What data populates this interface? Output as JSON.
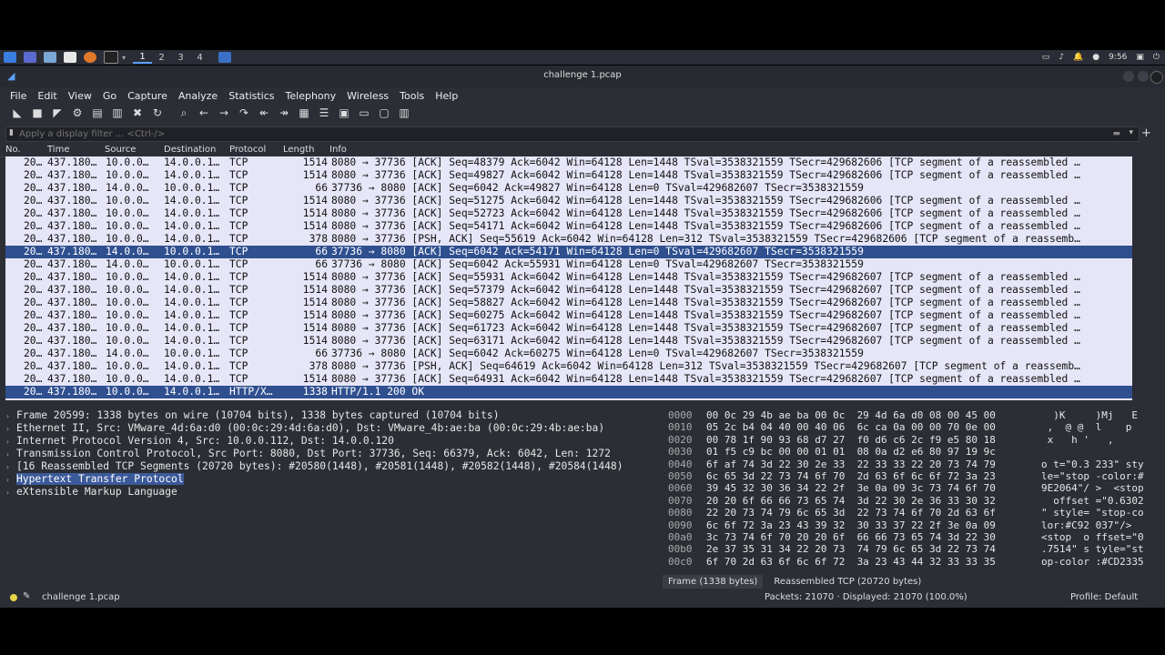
{
  "taskbar": {
    "workspaces": [
      "1",
      "2",
      "3",
      "4"
    ],
    "clock": "9:56"
  },
  "window": {
    "title": "challenge 1.pcap"
  },
  "menu": [
    "File",
    "Edit",
    "View",
    "Go",
    "Capture",
    "Analyze",
    "Statistics",
    "Telephony",
    "Wireless",
    "Tools",
    "Help"
  ],
  "filter": {
    "placeholder": "Apply a display filter ... <Ctrl-/>"
  },
  "packet_list": {
    "columns": [
      "No.",
      "Time",
      "Source",
      "Destination",
      "Protocol",
      "Length",
      "Info"
    ],
    "rows": [
      {
        "no": "20…",
        "time": "437.180…",
        "src": "10.0.0…",
        "dst": "14.0.0.1…",
        "proto": "TCP",
        "len": "1514",
        "info": "8080 → 37736 [ACK] Seq=48379 Ack=6042 Win=64128 Len=1448 TSval=3538321559 TSecr=429682606 [TCP segment of a reassembled …"
      },
      {
        "no": "20…",
        "time": "437.180…",
        "src": "10.0.0…",
        "dst": "14.0.0.1…",
        "proto": "TCP",
        "len": "1514",
        "info": "8080 → 37736 [ACK] Seq=49827 Ack=6042 Win=64128 Len=1448 TSval=3538321559 TSecr=429682606 [TCP segment of a reassembled …"
      },
      {
        "no": "20…",
        "time": "437.180…",
        "src": "14.0.0…",
        "dst": "10.0.0.1…",
        "proto": "TCP",
        "len": "66",
        "info": "37736 → 8080 [ACK] Seq=6042 Ack=49827 Win=64128 Len=0 TSval=429682607 TSecr=3538321559"
      },
      {
        "no": "20…",
        "time": "437.180…",
        "src": "10.0.0…",
        "dst": "14.0.0.1…",
        "proto": "TCP",
        "len": "1514",
        "info": "8080 → 37736 [ACK] Seq=51275 Ack=6042 Win=64128 Len=1448 TSval=3538321559 TSecr=429682606 [TCP segment of a reassembled …"
      },
      {
        "no": "20…",
        "time": "437.180…",
        "src": "10.0.0…",
        "dst": "14.0.0.1…",
        "proto": "TCP",
        "len": "1514",
        "info": "8080 → 37736 [ACK] Seq=52723 Ack=6042 Win=64128 Len=1448 TSval=3538321559 TSecr=429682606 [TCP segment of a reassembled …"
      },
      {
        "no": "20…",
        "time": "437.180…",
        "src": "10.0.0…",
        "dst": "14.0.0.1…",
        "proto": "TCP",
        "len": "1514",
        "info": "8080 → 37736 [ACK] Seq=54171 Ack=6042 Win=64128 Len=1448 TSval=3538321559 TSecr=429682606 [TCP segment of a reassembled …"
      },
      {
        "no": "20…",
        "time": "437.180…",
        "src": "10.0.0…",
        "dst": "14.0.0.1…",
        "proto": "TCP",
        "len": "378",
        "info": "8080 → 37736 [PSH, ACK] Seq=55619 Ack=6042 Win=64128 Len=312 TSval=3538321559 TSecr=429682606 [TCP segment of a reassemb…"
      },
      {
        "no": "20…",
        "time": "437.180…",
        "src": "14.0.0…",
        "dst": "10.0.0.1…",
        "proto": "TCP",
        "len": "66",
        "info": "37736 → 8080 [ACK] Seq=6042 Ack=54171 Win=64128 Len=0 TSval=429682607 TSecr=3538321559",
        "selected": true
      },
      {
        "no": "20…",
        "time": "437.180…",
        "src": "14.0.0…",
        "dst": "10.0.0.1…",
        "proto": "TCP",
        "len": "66",
        "info": "37736 → 8080 [ACK] Seq=6042 Ack=55931 Win=64128 Len=0 TSval=429682607 TSecr=3538321559"
      },
      {
        "no": "20…",
        "time": "437.180…",
        "src": "10.0.0…",
        "dst": "14.0.0.1…",
        "proto": "TCP",
        "len": "1514",
        "info": "8080 → 37736 [ACK] Seq=55931 Ack=6042 Win=64128 Len=1448 TSval=3538321559 TSecr=429682607 [TCP segment of a reassembled …"
      },
      {
        "no": "20…",
        "time": "437.180…",
        "src": "10.0.0…",
        "dst": "14.0.0.1…",
        "proto": "TCP",
        "len": "1514",
        "info": "8080 → 37736 [ACK] Seq=57379 Ack=6042 Win=64128 Len=1448 TSval=3538321559 TSecr=429682607 [TCP segment of a reassembled …"
      },
      {
        "no": "20…",
        "time": "437.180…",
        "src": "10.0.0…",
        "dst": "14.0.0.1…",
        "proto": "TCP",
        "len": "1514",
        "info": "8080 → 37736 [ACK] Seq=58827 Ack=6042 Win=64128 Len=1448 TSval=3538321559 TSecr=429682607 [TCP segment of a reassembled …"
      },
      {
        "no": "20…",
        "time": "437.180…",
        "src": "10.0.0…",
        "dst": "14.0.0.1…",
        "proto": "TCP",
        "len": "1514",
        "info": "8080 → 37736 [ACK] Seq=60275 Ack=6042 Win=64128 Len=1448 TSval=3538321559 TSecr=429682607 [TCP segment of a reassembled …"
      },
      {
        "no": "20…",
        "time": "437.180…",
        "src": "10.0.0…",
        "dst": "14.0.0.1…",
        "proto": "TCP",
        "len": "1514",
        "info": "8080 → 37736 [ACK] Seq=61723 Ack=6042 Win=64128 Len=1448 TSval=3538321559 TSecr=429682607 [TCP segment of a reassembled …"
      },
      {
        "no": "20…",
        "time": "437.180…",
        "src": "10.0.0…",
        "dst": "14.0.0.1…",
        "proto": "TCP",
        "len": "1514",
        "info": "8080 → 37736 [ACK] Seq=63171 Ack=6042 Win=64128 Len=1448 TSval=3538321559 TSecr=429682607 [TCP segment of a reassembled …"
      },
      {
        "no": "20…",
        "time": "437.180…",
        "src": "14.0.0…",
        "dst": "10.0.0.1…",
        "proto": "TCP",
        "len": "66",
        "info": "37736 → 8080 [ACK] Seq=6042 Ack=60275 Win=64128 Len=0 TSval=429682607 TSecr=3538321559"
      },
      {
        "no": "20…",
        "time": "437.180…",
        "src": "10.0.0…",
        "dst": "14.0.0.1…",
        "proto": "TCP",
        "len": "378",
        "info": "8080 → 37736 [PSH, ACK] Seq=64619 Ack=6042 Win=64128 Len=312 TSval=3538321559 TSecr=429682607 [TCP segment of a reassemb…"
      },
      {
        "no": "20…",
        "time": "437.180…",
        "src": "10.0.0…",
        "dst": "14.0.0.1…",
        "proto": "TCP",
        "len": "1514",
        "info": "8080 → 37736 [ACK] Seq=64931 Ack=6042 Win=64128 Len=1448 TSval=3538321559 TSecr=429682607 [TCP segment of a reassembled …"
      },
      {
        "no": "20…",
        "time": "437.180…",
        "src": "10.0.0…",
        "dst": "14.0.0.1…",
        "proto": "HTTP/X…",
        "len": "1338",
        "info": "HTTP/1.1 200 OK",
        "selected": true
      }
    ]
  },
  "details": [
    "Frame 20599: 1338 bytes on wire (10704 bits), 1338 bytes captured (10704 bits)",
    "Ethernet II, Src: VMware_4d:6a:d0 (00:0c:29:4d:6a:d0), Dst: VMware_4b:ae:ba (00:0c:29:4b:ae:ba)",
    "Internet Protocol Version 4, Src: 10.0.0.112, Dst: 14.0.0.120",
    "Transmission Control Protocol, Src Port: 8080, Dst Port: 37736, Seq: 66379, Ack: 6042, Len: 1272",
    "[16 Reassembled TCP Segments (20720 bytes): #20580(1448), #20581(1448), #20582(1448), #20584(1448)",
    "Hypertext Transfer Protocol",
    "eXtensible Markup Language"
  ],
  "bytes": [
    {
      "off": "0000",
      "hex": "00 0c 29 4b ae ba 00 0c  29 4d 6a d0 08 00 45 00",
      "ascii": "  )K     )Mj   E "
    },
    {
      "off": "0010",
      "hex": "05 2c b4 04 40 00 40 06  6c ca 0a 00 00 70 0e 00",
      "ascii": " ,  @ @  l    p  "
    },
    {
      "off": "0020",
      "hex": "00 78 1f 90 93 68 d7 27  f0 d6 c6 2c f9 e5 80 18",
      "ascii": " x   h '   ,    "
    },
    {
      "off": "0030",
      "hex": "01 f5 c9 bc 00 00 01 01  08 0a d2 e6 80 97 19 9c",
      "ascii": "                "
    },
    {
      "off": "0040",
      "hex": "6f af 74 3d 22 30 2e 33  22 33 33 22 20 73 74 79",
      "ascii": "o t=\"0.3 233\" sty"
    },
    {
      "off": "0050",
      "hex": "6c 65 3d 22 73 74 6f 70  2d 63 6f 6c 6f 72 3a 23",
      "ascii": "le=\"stop -color:#"
    },
    {
      "off": "0060",
      "hex": "39 45 32 30 36 34 22 2f  3e 0a 09 3c 73 74 6f 70",
      "ascii": "9E2064\"/ >  <stop"
    },
    {
      "off": "0070",
      "hex": "20 20 6f 66 66 73 65 74  3d 22 30 2e 36 33 30 32",
      "ascii": "  offset =\"0.6302"
    },
    {
      "off": "0080",
      "hex": "22 20 73 74 79 6c 65 3d  22 73 74 6f 70 2d 63 6f",
      "ascii": "\" style= \"stop-co"
    },
    {
      "off": "0090",
      "hex": "6c 6f 72 3a 23 43 39 32  30 33 37 22 2f 3e 0a 09",
      "ascii": "lor:#C92 037\"/>  "
    },
    {
      "off": "00a0",
      "hex": "3c 73 74 6f 70 20 20 6f  66 66 73 65 74 3d 22 30",
      "ascii": "<stop  o ffset=\"0"
    },
    {
      "off": "00b0",
      "hex": "2e 37 35 31 34 22 20 73  74 79 6c 65 3d 22 73 74",
      "ascii": ".7514\" s tyle=\"st"
    },
    {
      "off": "00c0",
      "hex": "6f 70 2d 63 6f 6c 6f 72  3a 23 43 44 32 33 33 35",
      "ascii": "op-color :#CD2335"
    }
  ],
  "bytes_tabs": [
    "Frame (1338 bytes)",
    "Reassembled TCP (20720 bytes)"
  ],
  "status": {
    "file": "challenge 1.pcap",
    "packets": "Packets: 21070 · Displayed: 21070 (100.0%)",
    "profile": "Profile: Default"
  }
}
